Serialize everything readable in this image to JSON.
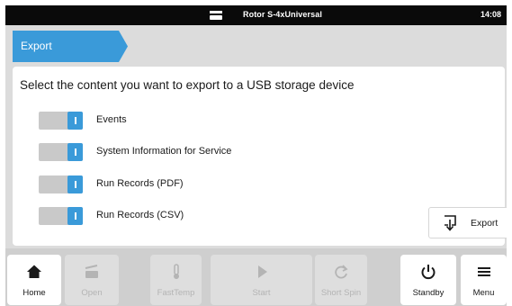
{
  "status_bar": {
    "rotor_name": "Rotor S-4xUniversal",
    "time": "14:08"
  },
  "breadcrumb": {
    "label": "Export"
  },
  "panel": {
    "instruction": "Select the content you want to export to a USB storage device",
    "options": [
      {
        "label": "Events",
        "enabled": true
      },
      {
        "label": "System Information for Service",
        "enabled": true
      },
      {
        "label": "Run Records (PDF)",
        "enabled": true
      },
      {
        "label": "Run Records (CSV)",
        "enabled": true
      }
    ],
    "export_button": {
      "label": "Export",
      "icon": "usb-export-icon"
    }
  },
  "bottom_nav": [
    {
      "label": "Home",
      "icon": "home-icon",
      "enabled": true
    },
    {
      "label": "Open",
      "icon": "lid-open-icon",
      "enabled": false
    },
    {
      "label": "FastTemp",
      "icon": "thermometer-icon",
      "enabled": false
    },
    {
      "label": "Start",
      "icon": "play-icon",
      "enabled": false
    },
    {
      "label": "Short Spin",
      "icon": "refresh-icon",
      "enabled": false
    },
    {
      "label": "Standby",
      "icon": "power-icon",
      "enabled": true
    },
    {
      "label": "Menu",
      "icon": "menu-icon",
      "enabled": true
    }
  ],
  "colors": {
    "accent": "#3a9ad9",
    "status_bar": "#0a0a0a",
    "background": "#dcdcdc",
    "toggle_track": "#c9c9c9"
  }
}
